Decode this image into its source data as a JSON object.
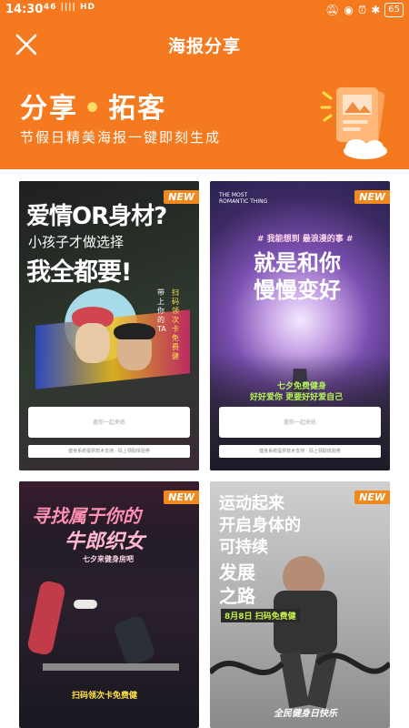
{
  "status": {
    "time": "14:30",
    "network": "46 |||| HD",
    "battery": "65"
  },
  "header": {
    "title": "海报分享"
  },
  "banner": {
    "title_a": "分享",
    "dot": "•",
    "title_b": "拓客",
    "subtitle": "节假日精美海报一键即刻生成"
  },
  "new_label": "NEW",
  "posters": [
    {
      "line1": "爱情OR身材?",
      "line2": "小孩子才做选择",
      "line3": "我全都要!",
      "side_a": "带上你的TA",
      "side_b": "扫码领次卡免费健",
      "slot_text": "邀你一起来练",
      "footer": "健身系统提供技术支持 · 码上领取体验券"
    },
    {
      "kicker": "THE MOST ROMANTIC THING",
      "hashtag": "# 我能想到 最浪漫的事 #",
      "line1": "就是和你",
      "line2": "慢慢变好",
      "tagline": "七夕免费健身",
      "tagline2": "好好爱你 更要好好爱自己",
      "slot_text": "邀你一起来练",
      "footer": "健身系统提供技术支持 · 码上领取体验券"
    },
    {
      "line1": "寻找属于你的",
      "line2": "牛郎织女",
      "line3": "七夕来健身房吧",
      "cta": "扫码领次卡免费健"
    },
    {
      "line1": "运动起来",
      "line2": "开启身体的",
      "line3": "可持续",
      "line4": "发展",
      "line5": "之路",
      "tag": "8月8日 扫码免费健",
      "footer_text": "全民健身日快乐"
    }
  ]
}
